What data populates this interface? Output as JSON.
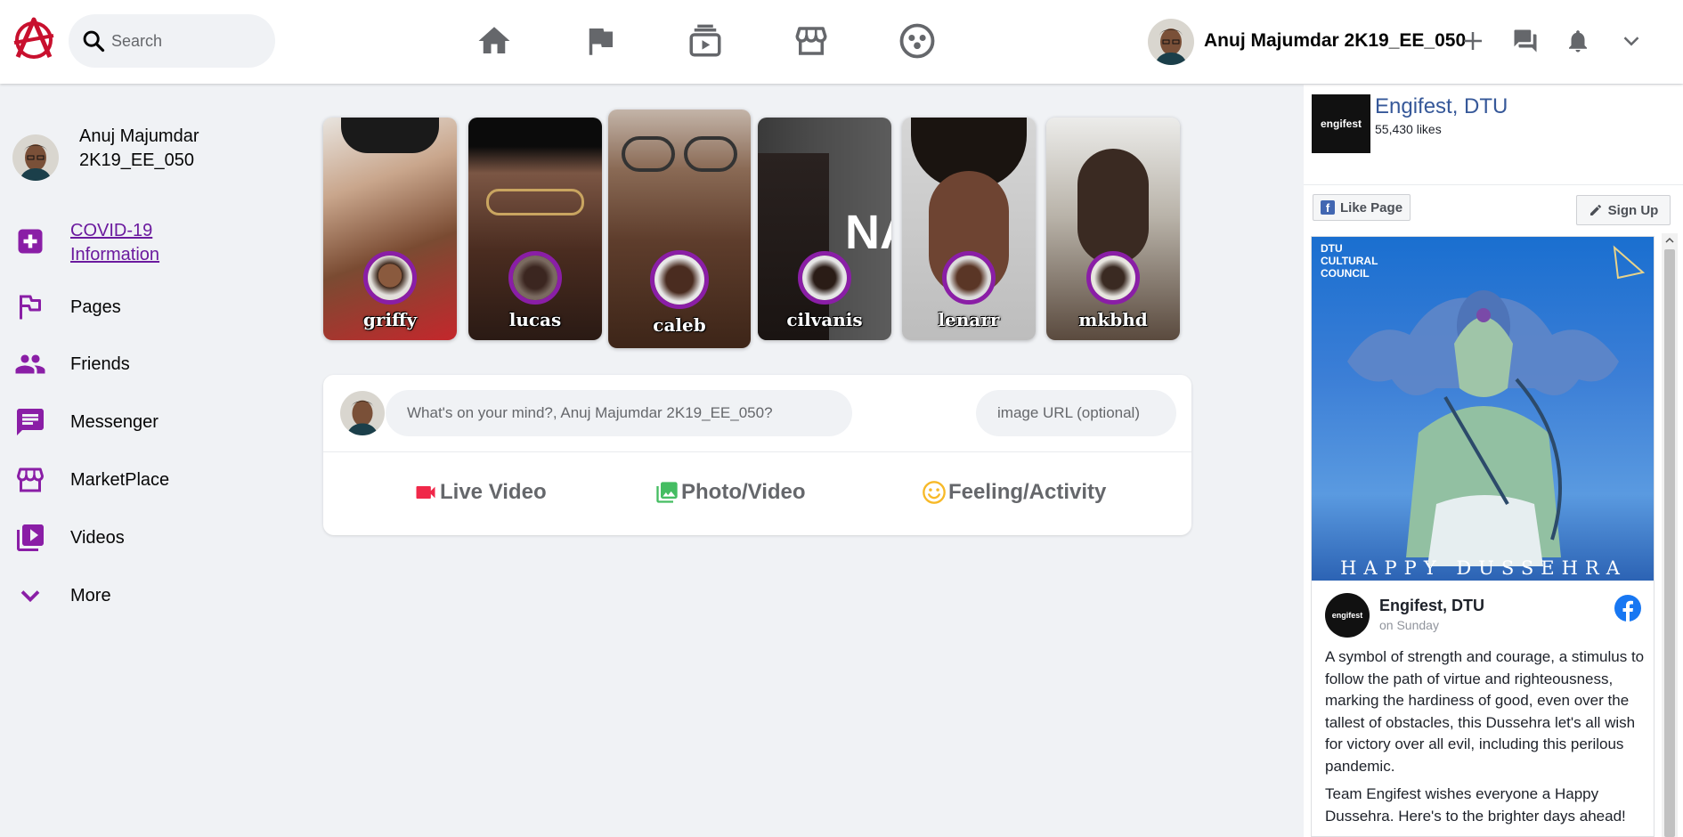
{
  "header": {
    "search_placeholder": "Search",
    "user_name": "Anuj Majumdar 2K19_EE_050",
    "nav": [
      {
        "icon": "home-icon"
      },
      {
        "icon": "flag-icon"
      },
      {
        "icon": "video-icon"
      },
      {
        "icon": "store-icon"
      },
      {
        "icon": "groups-icon"
      }
    ],
    "actions": [
      "plus-icon",
      "messenger-icon",
      "notifications-icon",
      "chevron-down-icon"
    ]
  },
  "sidebar": {
    "profile_name": "Anuj Majumdar 2K19_EE_050",
    "covid_link": "COVID-19 Information",
    "items": [
      {
        "label": "Pages",
        "icon": "flag-icon"
      },
      {
        "label": "Friends",
        "icon": "friends-icon"
      },
      {
        "label": "Messenger",
        "icon": "message-icon"
      },
      {
        "label": "MarketPlace",
        "icon": "store-icon"
      },
      {
        "label": "Videos",
        "icon": "video-library-icon"
      },
      {
        "label": "More",
        "icon": "chevron-down-icon"
      }
    ]
  },
  "stories": [
    {
      "name": "griffy"
    },
    {
      "name": "lucas"
    },
    {
      "name": "caleb"
    },
    {
      "name": "cilvanis"
    },
    {
      "name": "lenarr"
    },
    {
      "name": "mkbhd"
    }
  ],
  "stories_overlay_text": "NA",
  "composer": {
    "placeholder": "What's on your mind?, Anuj Majumdar 2K19_EE_050?",
    "url_placeholder": "image URL (optional)",
    "options": [
      {
        "label": "Live Video",
        "icon": "live-video-icon",
        "color": "#f02849"
      },
      {
        "label": "Photo/Video",
        "icon": "photo-icon",
        "color": "#45bd62"
      },
      {
        "label": "Feeling/Activity",
        "icon": "smile-icon",
        "color": "#f7b928"
      }
    ]
  },
  "page_widget": {
    "thumb_text": "engifest",
    "title": "Engifest, DTU",
    "likes": "55,430 likes",
    "like_button": "Like Page",
    "signup_button": "Sign Up",
    "poster_top": "DTU CULTURAL COUNCIL",
    "poster_bottom": "HAPPY DUSSEHRA",
    "post_author": "Engifest, DTU",
    "post_date": "on Sunday",
    "post_text_1": "A symbol of strength and courage, a stimulus to follow the path of virtue and righteousness, marking the hardiness of good, even over the tallest of obstacles, this Dussehra let's all wish for victory over all evil, including this perilous pandemic.",
    "post_text_2": "Team Engifest wishes everyone a Happy Dussehra. Here's to the brighter days ahead!"
  },
  "colors": {
    "accent": "#8a1ea6",
    "brand_red": "#c8102e",
    "link": "#365899",
    "facebook_blue": "#1877f2"
  }
}
